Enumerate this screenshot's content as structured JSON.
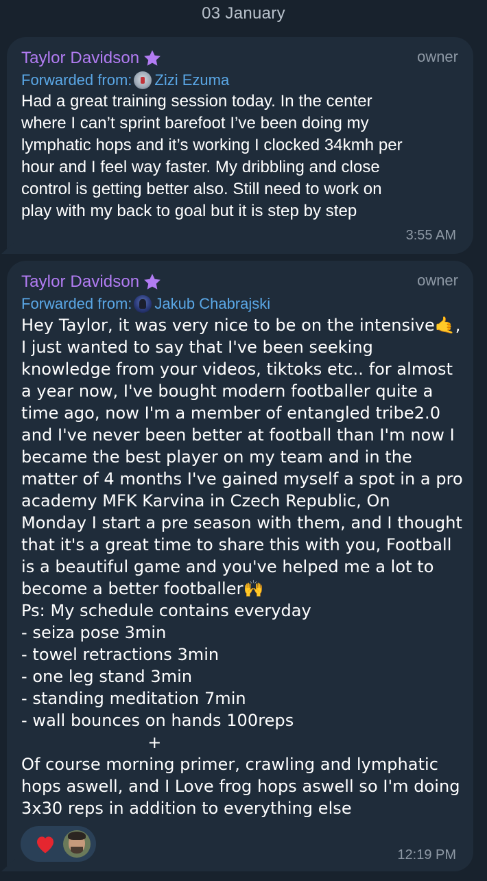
{
  "date_separator": "03 January",
  "messages": [
    {
      "sender": "Taylor Davidson",
      "role": "owner",
      "forwarded_label": "Forwarded from:",
      "forwarded_from": "Zizi Ezuma",
      "text": "Had a great training session today. In the center\nwhere I can’t sprint barefoot I’ve been doing my\nlymphatic hops and it’s working I clocked 34kmh per\nhour and I feel way faster. My dribbling and close\ncontrol is getting better also. Still need to work on\nplay with my back to goal but it is step by step",
      "time": "3:55 AM"
    },
    {
      "sender": "Taylor Davidson",
      "role": "owner",
      "forwarded_label": "Forwarded from:",
      "forwarded_from": "Jakub Chabrajski",
      "text": "Hey Taylor, it was very nice to be on the intensive🤙,\nI just wanted to say that I've been seeking\nknowledge from your videos, tiktoks etc.. for almost\na year now, I've bought modern footballer quite a\ntime ago, now I'm a member of entangled tribe2.0\nand I've never been better at football than I'm now I\nbecame the best player on my team and in the\nmatter of 4 months I've gained myself a spot in a pro\nacademy MFK Karvina in Czech Republic, On\nMonday I start a pre season with them, and I thought\nthat it's a great time to share this with you, Football\nis a beautiful game and you've helped me a lot to\nbecome a better footballer🙌\nPs: My schedule contains everyday\n- seiza pose 3min\n- towel retractions 3min\n- one leg stand 3min\n- standing meditation 7min\n- wall bounces on hands 100reps\n                        +\nOf course morning primer, crawling and lymphatic\nhops aswell, and I Love frog hops aswell so I'm doing\n3x30 reps in addition to everything else",
      "time": "12:19 PM",
      "reaction": "heart-icon"
    }
  ],
  "colors": {
    "background": "#18222d",
    "bubble": "#1f2c3a",
    "sender_name": "#b27cf3",
    "forwarded": "#5aa7e6",
    "meta": "#8e99a5",
    "reaction_pill": "#2a4057",
    "heart": "#e5262f"
  },
  "icons": {
    "sender_badge": "star-icon",
    "reaction": "heart-icon"
  }
}
